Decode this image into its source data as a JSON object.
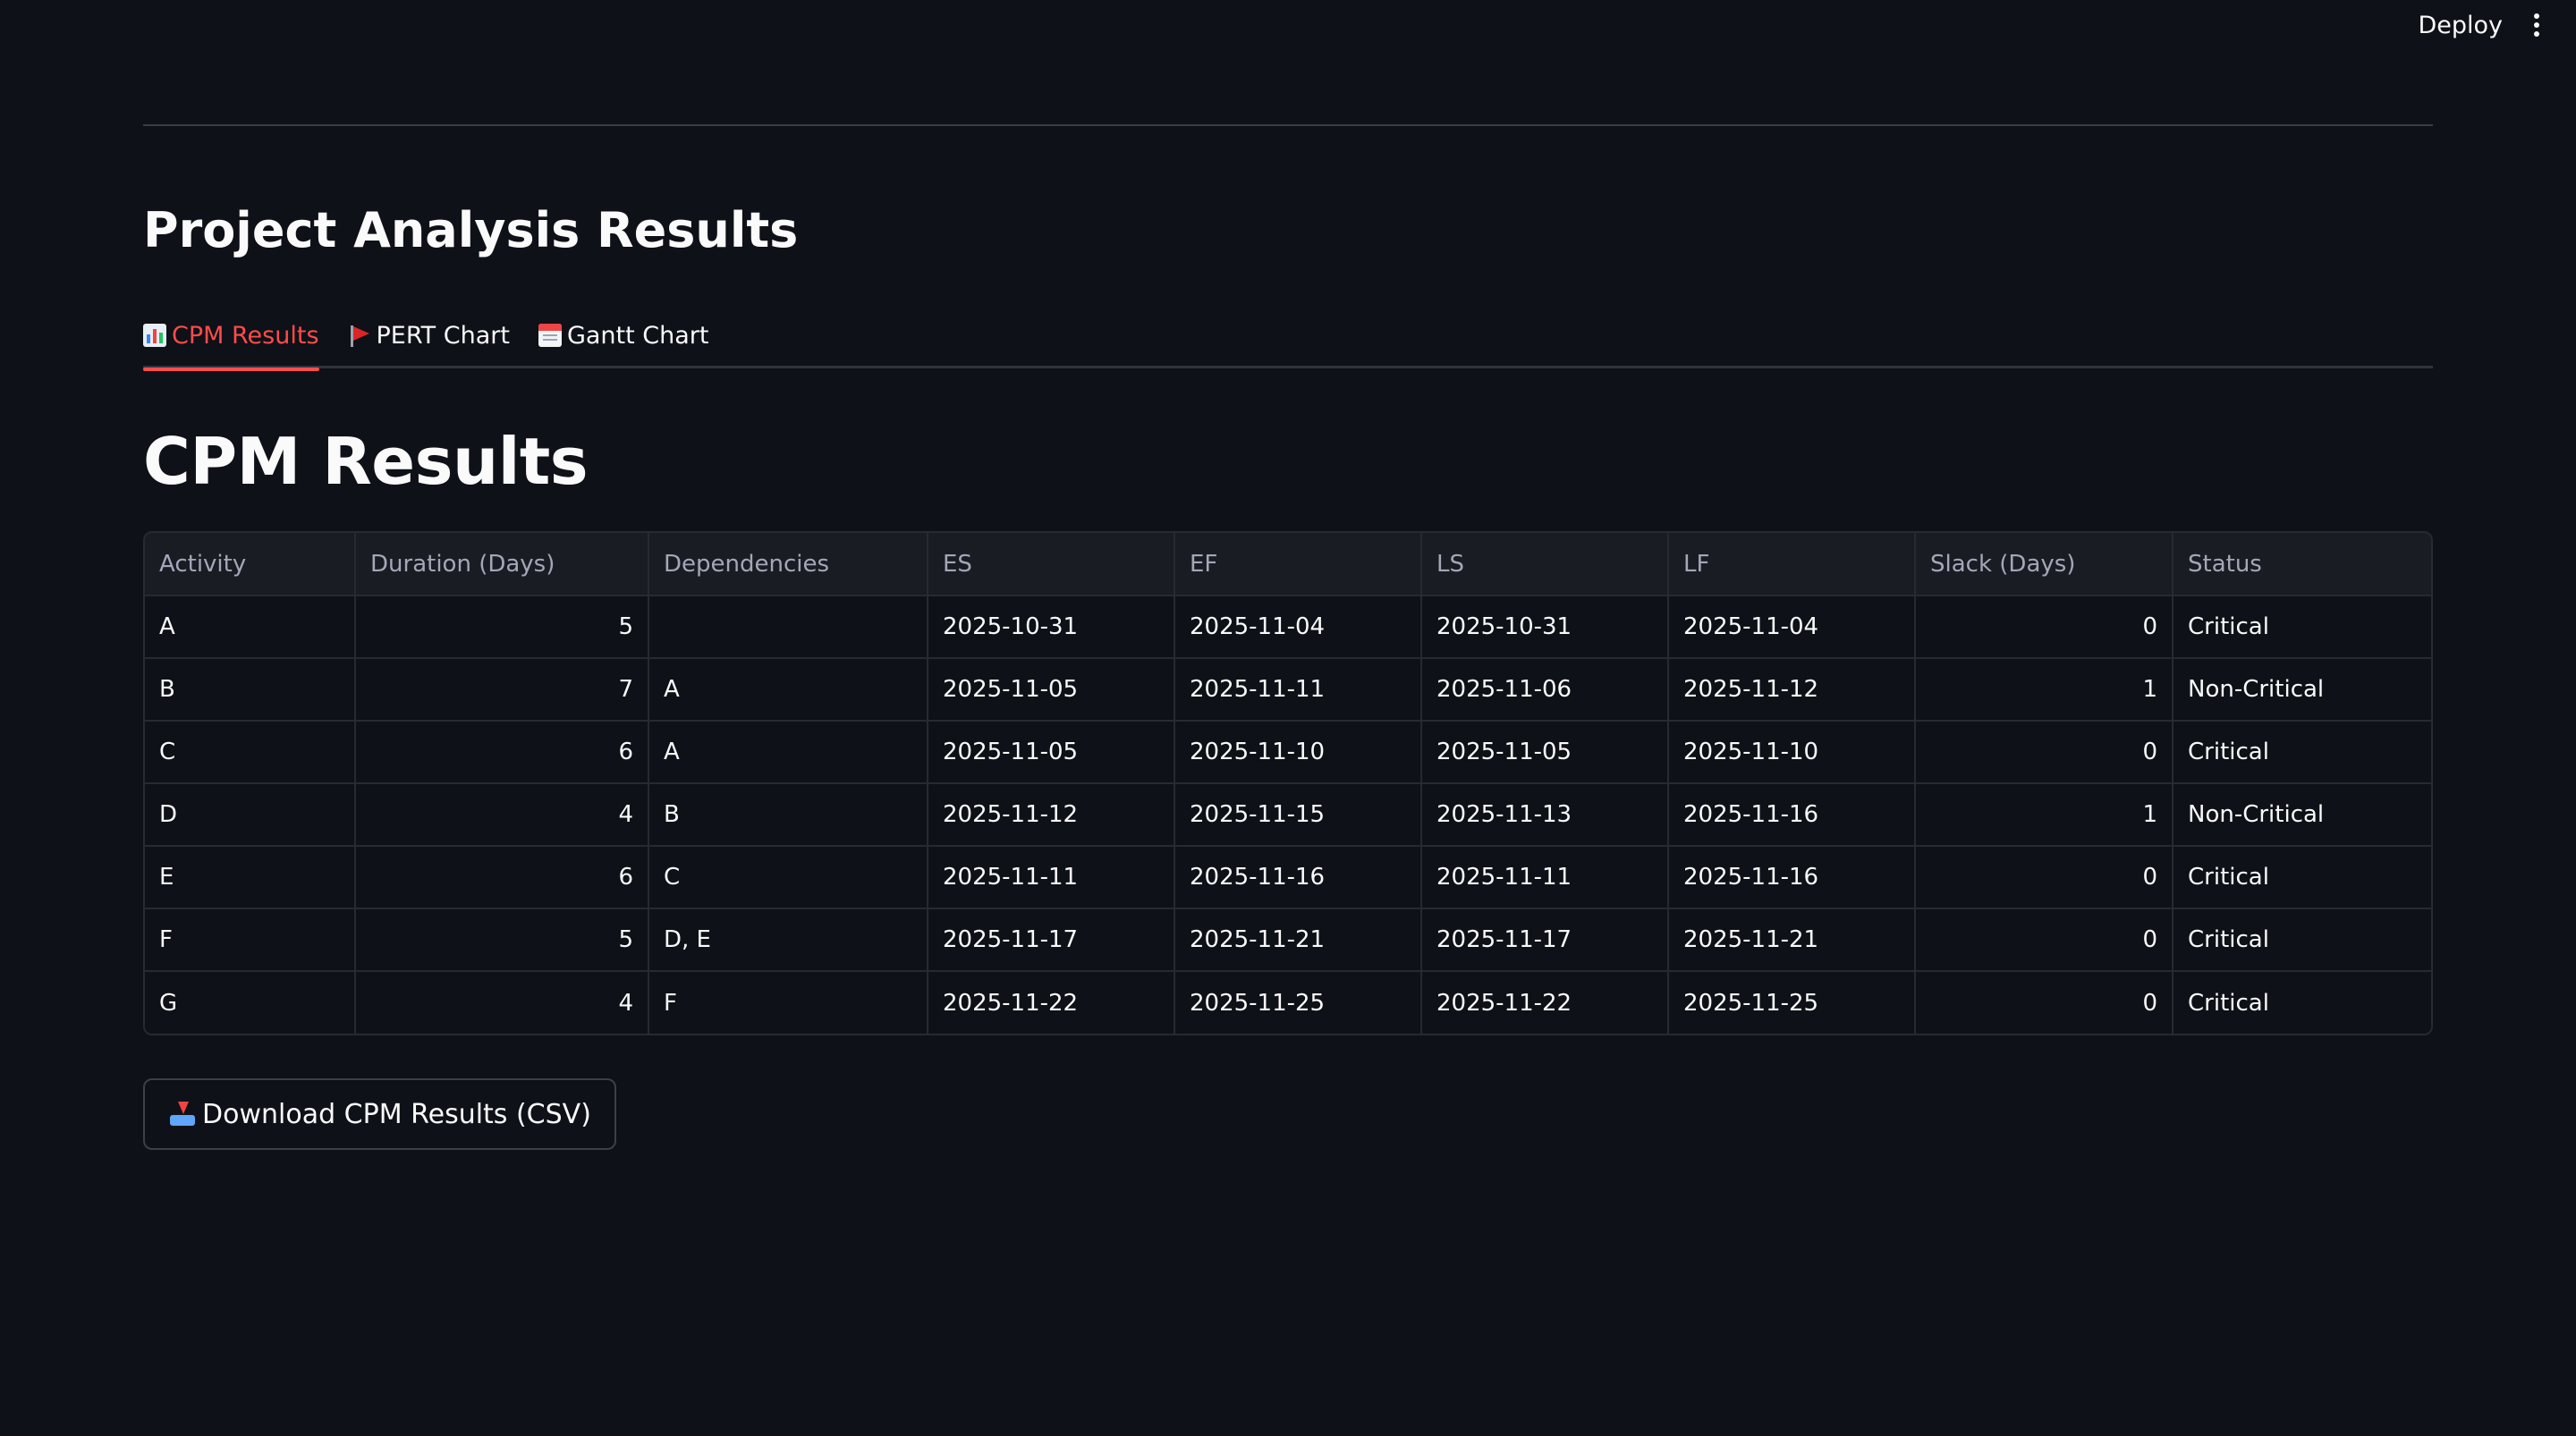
{
  "toolbar": {
    "deploy_label": "Deploy",
    "menu_icon": "more-vertical-icon"
  },
  "section": {
    "title": "Project Analysis Results"
  },
  "tabs": [
    {
      "label": "CPM Results",
      "icon": "bar-chart-icon",
      "active": true
    },
    {
      "label": "PERT Chart",
      "icon": "flag-icon",
      "active": false
    },
    {
      "label": "Gantt Chart",
      "icon": "calendar-icon",
      "active": false
    }
  ],
  "page": {
    "title": "CPM Results"
  },
  "table": {
    "headers": [
      "Activity",
      "Duration (Days)",
      "Dependencies",
      "ES",
      "EF",
      "LS",
      "LF",
      "Slack (Days)",
      "Status"
    ],
    "rows": [
      [
        "A",
        "5",
        "",
        "2025-10-31",
        "2025-11-04",
        "2025-10-31",
        "2025-11-04",
        "0",
        "Critical"
      ],
      [
        "B",
        "7",
        "A",
        "2025-11-05",
        "2025-11-11",
        "2025-11-06",
        "2025-11-12",
        "1",
        "Non-Critical"
      ],
      [
        "C",
        "6",
        "A",
        "2025-11-05",
        "2025-11-10",
        "2025-11-05",
        "2025-11-10",
        "0",
        "Critical"
      ],
      [
        "D",
        "4",
        "B",
        "2025-11-12",
        "2025-11-15",
        "2025-11-13",
        "2025-11-16",
        "1",
        "Non-Critical"
      ],
      [
        "E",
        "6",
        "C",
        "2025-11-11",
        "2025-11-16",
        "2025-11-11",
        "2025-11-16",
        "0",
        "Critical"
      ],
      [
        "F",
        "5",
        "D, E",
        "2025-11-17",
        "2025-11-21",
        "2025-11-17",
        "2025-11-21",
        "0",
        "Critical"
      ],
      [
        "G",
        "4",
        "F",
        "2025-11-22",
        "2025-11-25",
        "2025-11-22",
        "2025-11-25",
        "0",
        "Critical"
      ]
    ]
  },
  "download": {
    "label": "Download CPM Results (CSV)",
    "icon": "inbox-tray-icon"
  },
  "colors": {
    "background": "#0e1117",
    "accent": "#ff4b4b",
    "text": "#fafafa",
    "header_text": "#a3a8b8"
  }
}
